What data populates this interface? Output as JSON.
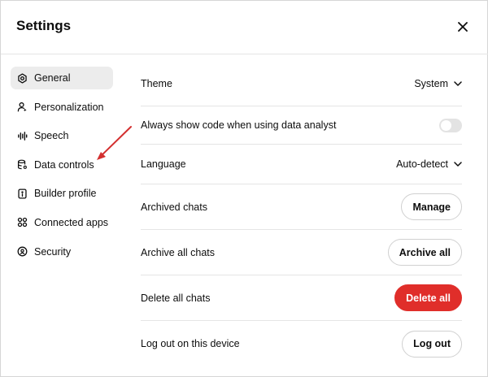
{
  "header": {
    "title": "Settings",
    "close_icon": "close-icon"
  },
  "sidebar": {
    "items": [
      {
        "label": "General",
        "icon": "gear-icon",
        "active": true
      },
      {
        "label": "Personalization",
        "icon": "person-icon"
      },
      {
        "label": "Speech",
        "icon": "waveform-icon"
      },
      {
        "label": "Data controls",
        "icon": "database-icon"
      },
      {
        "label": "Builder profile",
        "icon": "id-card-icon"
      },
      {
        "label": "Connected apps",
        "icon": "apps-grid-icon"
      },
      {
        "label": "Security",
        "icon": "shield-icon"
      }
    ]
  },
  "settings": {
    "theme": {
      "label": "Theme",
      "value": "System"
    },
    "show_code": {
      "label": "Always show code when using data analyst",
      "enabled": false
    },
    "language": {
      "label": "Language",
      "value": "Auto-detect"
    },
    "archived_chats": {
      "label": "Archived chats",
      "button": "Manage"
    },
    "archive_all": {
      "label": "Archive all chats",
      "button": "Archive all"
    },
    "delete_all": {
      "label": "Delete all chats",
      "button": "Delete all"
    },
    "log_out": {
      "label": "Log out on this device",
      "button": "Log out"
    }
  },
  "colors": {
    "danger": "#e02e2a",
    "annotation_arrow": "#d32f2f",
    "active_nav": "#ececec"
  }
}
